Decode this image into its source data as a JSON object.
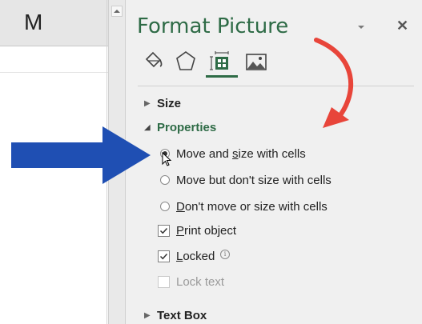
{
  "sheet": {
    "column_letter": "M"
  },
  "pane": {
    "title": "Format Picture",
    "tabs": [
      "fill-line-icon",
      "effects-icon",
      "size-properties-icon",
      "picture-icon"
    ],
    "selected_tab": "size-properties-icon",
    "accent_color": "#2e6b46",
    "sections": {
      "size": "Size",
      "properties": "Properties",
      "text_box": "Text Box"
    },
    "properties": {
      "radio_1": {
        "prefix": "Move and ",
        "underlined": "s",
        "suffix": "ize with cells",
        "checked": true
      },
      "radio_2": {
        "prefix": "Move but don't size with cells",
        "checked": false
      },
      "radio_3": {
        "underlined": "D",
        "suffix": "on't move or size with cells",
        "checked": false
      },
      "print_object": {
        "underlined": "P",
        "suffix": "rint object",
        "checked": true
      },
      "locked": {
        "underlined": "L",
        "suffix": "ocked",
        "checked": true
      },
      "lock_text": {
        "label": "Lock text",
        "checked": false,
        "disabled": true
      }
    }
  },
  "annotations": {
    "blue_arrow_color": "#1f4fb3",
    "red_arrow_color": "#e8453a"
  }
}
